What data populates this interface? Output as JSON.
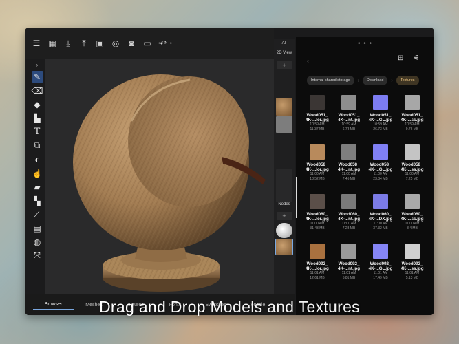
{
  "toolbar": {
    "icons": [
      "menu-icon",
      "grid-icon",
      "download-icon",
      "upload-icon",
      "image-icon",
      "target-icon",
      "camera-icon",
      "video-icon",
      "undo-icon"
    ],
    "grip": "• • •"
  },
  "tools": [
    "brush-icon",
    "eraser-icon",
    "fill-bucket-icon",
    "smudge-icon",
    "text-icon",
    "transform-icon",
    "opacity-icon",
    "hand-pick-icon",
    "projection-icon",
    "layer-mask-icon",
    "eyedropper-icon",
    "adjust-icon",
    "material-icon",
    "axis-icon"
  ],
  "strip": {
    "all_label": "All",
    "view_label": "2D View",
    "nodes_label": "Nodes",
    "plus": "+"
  },
  "bottom_tabs": {
    "items": [
      "Browser",
      "Meshes",
      "Textures",
      "Fonts",
      "Swatches",
      "Console"
    ],
    "active": "Browser",
    "collapse": "‹"
  },
  "browser": {
    "grip": "• • •",
    "back": "←",
    "breadcrumbs": [
      "Internal shared storage",
      "Download",
      "Textures"
    ],
    "files": [
      {
        "name1": "Wood051_",
        "name2": "4K-...lor.jpg",
        "time": "10:59 AM",
        "size": "11.37 MB",
        "color": "#3b3634"
      },
      {
        "name1": "Wood051_",
        "name2": "4K-...nt.jpg",
        "time": "10:59 AM",
        "size": "6.73 MB",
        "color": "#8d8d8d"
      },
      {
        "name1": "Wood051_",
        "name2": "4K-...GL.jpg",
        "time": "10:59 AM",
        "size": "26.73 MB",
        "color": "#7c7cf2"
      },
      {
        "name1": "Wood051_",
        "name2": "4K-...ss.jpg",
        "time": "10:59 AM",
        "size": "9.76 MB",
        "color": "#a7a7a7"
      },
      {
        "name1": "Wood058_",
        "name2": "4K-...lor.jpg",
        "time": "11:00 AM",
        "size": "18.52 MB",
        "color": "#b88a5c"
      },
      {
        "name1": "Wood058_",
        "name2": "4K-...nt.jpg",
        "time": "11:00 AM",
        "size": "7.45 MB",
        "color": "#7e7e7e"
      },
      {
        "name1": "Wood058_",
        "name2": "4K-...GL.jpg",
        "time": "11:00 AM",
        "size": "23.84 MB",
        "color": "#8080f5"
      },
      {
        "name1": "Wood058_",
        "name2": "4K-...ss.jpg",
        "time": "11:00 AM",
        "size": "7.25 MB",
        "color": "#c4c4c4"
      },
      {
        "name1": "Wood060_",
        "name2": "4K-...lor.jpg",
        "time": "11:00 AM",
        "size": "31.43 MB",
        "color": "#5b4f49"
      },
      {
        "name1": "Wood060_",
        "name2": "4K-...nt.jpg",
        "time": "11:00 AM",
        "size": "7.23 MB",
        "color": "#7a7a7a"
      },
      {
        "name1": "Wood060_",
        "name2": "4K-...DX.jpg",
        "time": "11:00 AM",
        "size": "37.32 MB",
        "color": "#7b7be6"
      },
      {
        "name1": "Wood060_",
        "name2": "4K-...ss.jpg",
        "time": "11:00 AM",
        "size": "8.4 MB",
        "color": "#a9a9a9"
      },
      {
        "name1": "Wood092_",
        "name2": "4K-...lor.jpg",
        "time": "11:01 AM",
        "size": "12.61 MB",
        "color": "#a9713f"
      },
      {
        "name1": "Wood092_",
        "name2": "4K-...nt.jpg",
        "time": "11:01 AM",
        "size": "5.81 MB",
        "color": "#9a9a9a"
      },
      {
        "name1": "Wood092_",
        "name2": "4K-...GL.jpg",
        "time": "11:01 AM",
        "size": "17.49 MB",
        "color": "#8585f6"
      },
      {
        "name1": "Wood092_",
        "name2": "4K-...ss.jpg",
        "time": "11:01 AM",
        "size": "5.13 MB",
        "color": "#cfcfcf"
      }
    ]
  },
  "caption": {
    "strong": "Drag and Drop",
    "light": " Models and Textures"
  },
  "colors": {
    "accent": "#2d4b7d",
    "breadcrumb_active": "#f0c983",
    "wood": "#a27c52"
  }
}
